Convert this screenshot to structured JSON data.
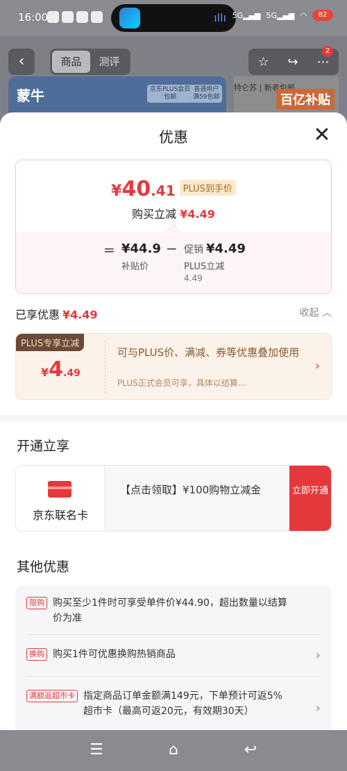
{
  "status_bar": {
    "time": "16:00",
    "battery": "82"
  },
  "product_nav": {
    "tabs": [
      {
        "label": "商品"
      },
      {
        "label": "测评"
      }
    ],
    "badge_count": "2"
  },
  "promo": {
    "brand": "蒙牛",
    "tag1": "京东PLUS会员\n包邮",
    "tag2": "普通用户\n满59包邮",
    "right_text": "特仑苏 | 新老包邮",
    "right_big": "百亿补贴"
  },
  "sheet": {
    "title": "优惠",
    "price": {
      "yen": "¥",
      "int": "40",
      "dec": ".41",
      "tag": "PLUS到手价",
      "sub_label": "购买立减",
      "sub_value": "¥4.49",
      "eq": "=",
      "base_value": "¥44.9",
      "base_label": "补贴价",
      "minus": "−",
      "promo_label": "促销",
      "promo_value": "¥4.49",
      "promo_desc": "PLUS立减",
      "promo_sub": "4.49"
    },
    "enjoyed": {
      "label": "已享优惠",
      "value": "¥4.49",
      "collapse": "收起"
    },
    "plus_card": {
      "badge": "PLUS专享立减",
      "yen": "¥",
      "int": "4",
      "dec": ".49",
      "desc": "可与PLUS价、满减、券等优惠叠加使用",
      "note": "PLUS正式会员可享，具体以结算..."
    },
    "open_section": {
      "title": "开通立享",
      "card_name": "京东联名卡",
      "card_desc": "【点击领取】¥100购物立减金",
      "button": "立即开通"
    },
    "other_section": {
      "title": "其他优惠",
      "items": [
        {
          "tag": "限购",
          "text": "购买至少1件时可享受单件价¥44.90，超出数量以结算价为准"
        },
        {
          "tag": "换购",
          "text": "购买1件可优惠换购热销商品"
        },
        {
          "tag": "满额返超市卡",
          "text": "指定商品订单金额满149元，下单预计可返5%超市卡（最高可返20元，有效期30天）"
        }
      ]
    }
  }
}
